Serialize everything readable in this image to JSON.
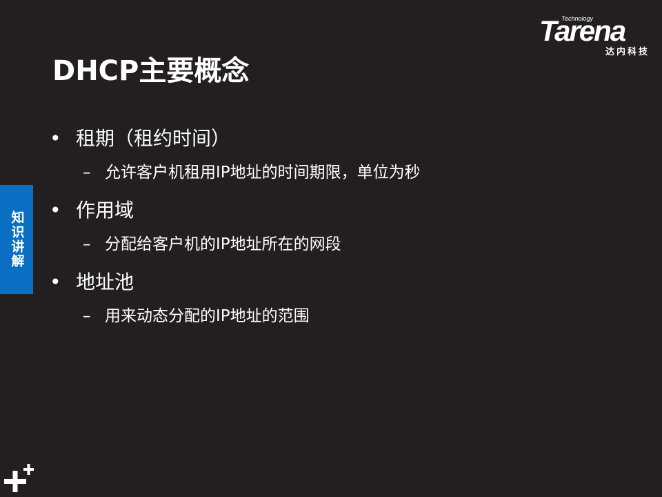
{
  "slide": {
    "title": "DHCP主要概念",
    "logo": {
      "technology": "Technology",
      "wordmark": "Tarena",
      "chinese_name": "达内科技"
    },
    "side_tab": "知识讲解",
    "bullets": [
      {
        "text": "租期（租约时间）",
        "sub": "允许客户机租用IP地址的时间期限，单位为秒"
      },
      {
        "text": "作用域",
        "sub": "分配给客户机的IP地址所在的网段"
      },
      {
        "text": "地址池",
        "sub": "用来动态分配的IP地址的范围"
      }
    ],
    "bullet_glyph": "•",
    "sub_glyph": "–"
  },
  "colors": {
    "background": "#231f20",
    "text": "#ffffff",
    "tab": "#0a6fc2"
  }
}
